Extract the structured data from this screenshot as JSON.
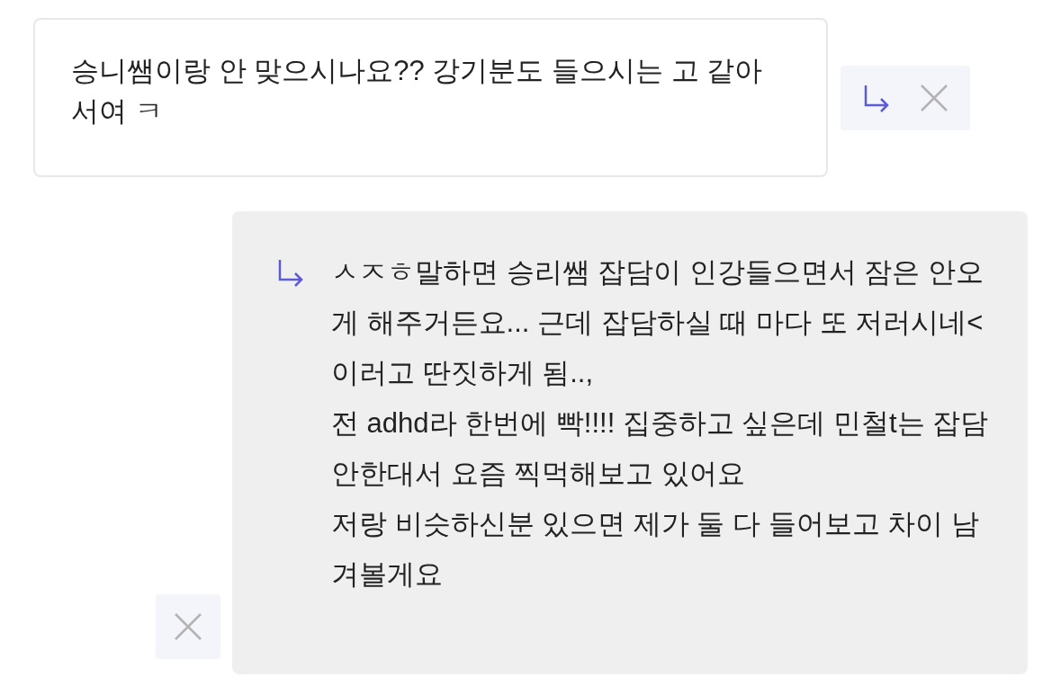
{
  "comment": {
    "text": "승니쌤이랑 안 맞으시나요?? 강기분도 들으시는 고 같아서여 ㅋ"
  },
  "reply": {
    "text": "ㅅㅈㅎ말하면 승리쌤 잡담이 인강들으면서 잠은 안오게 해주거든요... 근데 잡담하실 때 마다 또 저러시네<이러고 딴짓하게 됨..,\n전 adhd라 한번에 빡!!!! 집중하고 싶은데 민철t는 잡담 안한대서 요즘 찍먹해보고 있어요\n저랑 비슷하신분 있으면 제가 둘 다 들어보고 차이 남겨볼게요"
  }
}
